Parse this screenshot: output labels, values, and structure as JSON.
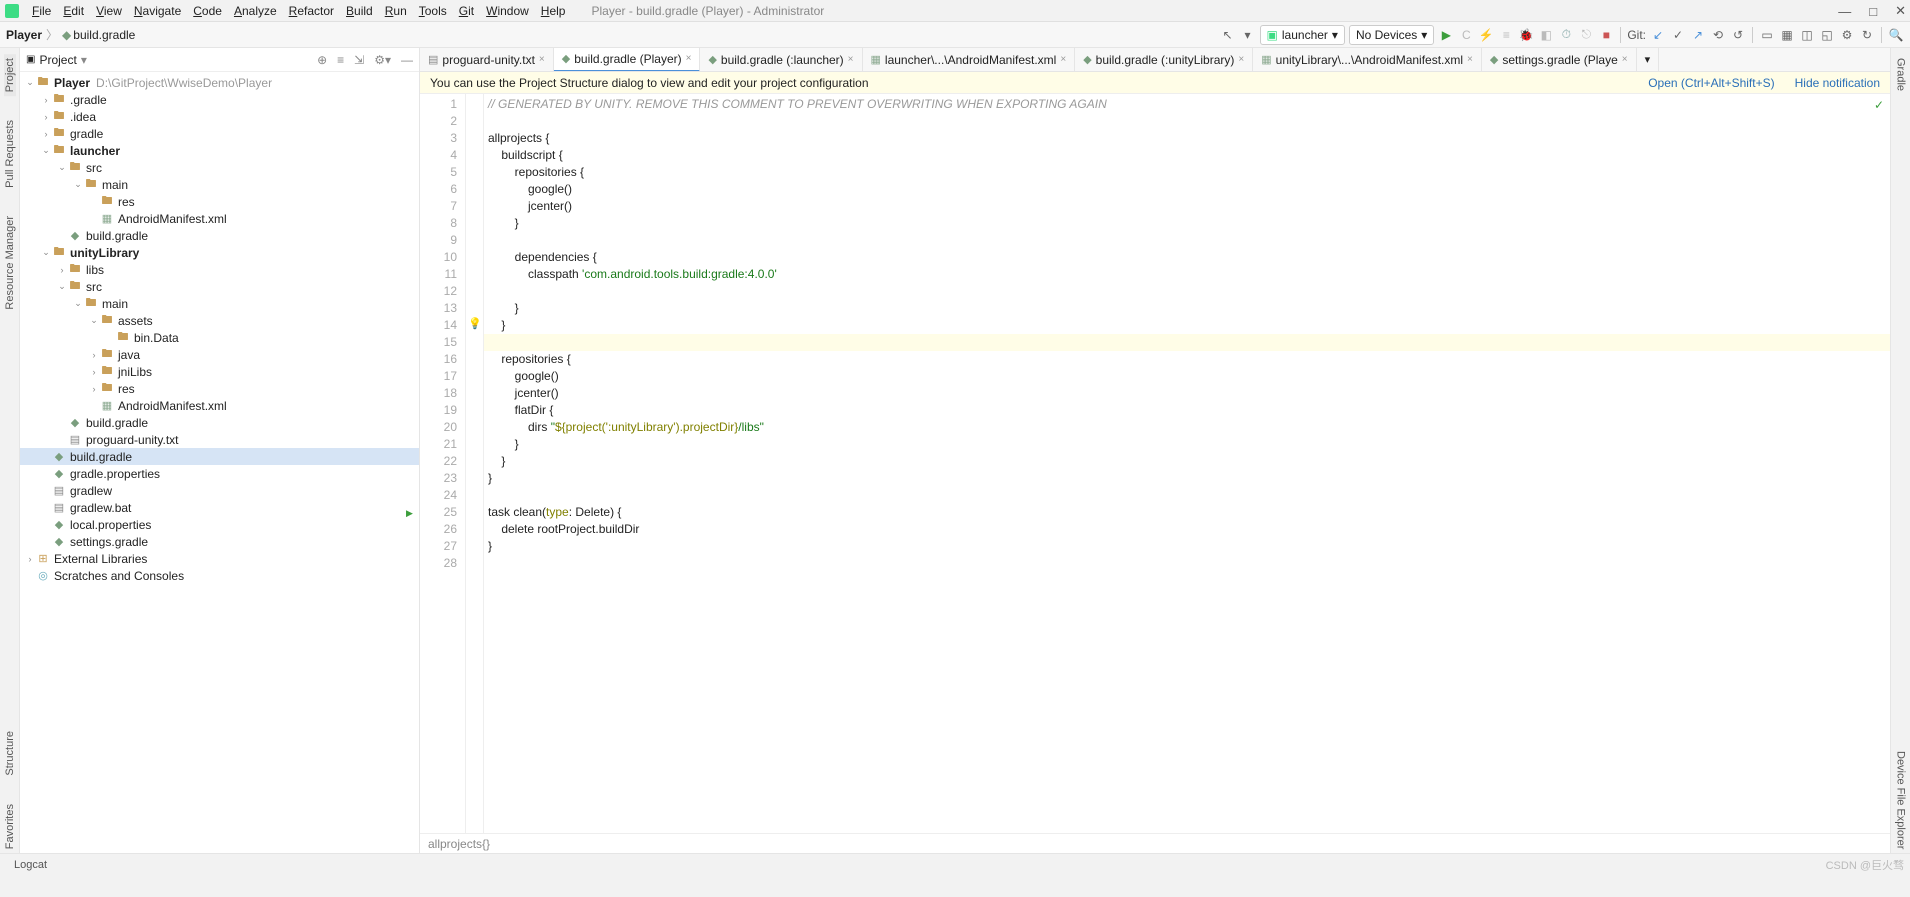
{
  "window": {
    "title": "Player - build.gradle (Player) - Administrator"
  },
  "menu": [
    "File",
    "Edit",
    "View",
    "Navigate",
    "Code",
    "Analyze",
    "Refactor",
    "Build",
    "Run",
    "Tools",
    "Git",
    "Window",
    "Help"
  ],
  "breadcrumb": {
    "root": "Player",
    "file": "build.gradle"
  },
  "toolbar": {
    "run_config": "launcher",
    "devices": "No Devices",
    "git_label": "Git:"
  },
  "project_panel": {
    "title": "Project"
  },
  "tree": [
    {
      "d": 0,
      "a": "v",
      "i": "folder",
      "t": "Player",
      "meta": "D:\\GitProject\\WwiseDemo\\Player",
      "bold": true
    },
    {
      "d": 1,
      "a": ">",
      "i": "folder",
      "t": ".gradle"
    },
    {
      "d": 1,
      "a": ">",
      "i": "folder",
      "t": ".idea"
    },
    {
      "d": 1,
      "a": ">",
      "i": "folder",
      "t": "gradle"
    },
    {
      "d": 1,
      "a": "v",
      "i": "folder",
      "t": "launcher",
      "bold": true
    },
    {
      "d": 2,
      "a": "v",
      "i": "folder",
      "t": "src"
    },
    {
      "d": 3,
      "a": "v",
      "i": "folder",
      "t": "main"
    },
    {
      "d": 4,
      "a": "",
      "i": "folder",
      "t": "res"
    },
    {
      "d": 4,
      "a": "",
      "i": "xfile",
      "t": "AndroidManifest.xml"
    },
    {
      "d": 2,
      "a": "",
      "i": "gfile",
      "t": "build.gradle"
    },
    {
      "d": 1,
      "a": "v",
      "i": "folder",
      "t": "unityLibrary",
      "bold": true
    },
    {
      "d": 2,
      "a": ">",
      "i": "folder",
      "t": "libs"
    },
    {
      "d": 2,
      "a": "v",
      "i": "folder",
      "t": "src"
    },
    {
      "d": 3,
      "a": "v",
      "i": "folder",
      "t": "main"
    },
    {
      "d": 4,
      "a": "v",
      "i": "folder",
      "t": "assets"
    },
    {
      "d": 5,
      "a": "",
      "i": "folder",
      "t": "bin.Data"
    },
    {
      "d": 4,
      "a": ">",
      "i": "folder",
      "t": "java"
    },
    {
      "d": 4,
      "a": ">",
      "i": "folder",
      "t": "jniLibs"
    },
    {
      "d": 4,
      "a": ">",
      "i": "folder",
      "t": "res"
    },
    {
      "d": 4,
      "a": "",
      "i": "xfile",
      "t": "AndroidManifest.xml"
    },
    {
      "d": 2,
      "a": "",
      "i": "gfile",
      "t": "build.gradle"
    },
    {
      "d": 2,
      "a": "",
      "i": "file",
      "t": "proguard-unity.txt"
    },
    {
      "d": 1,
      "a": "",
      "i": "gfile",
      "t": "build.gradle",
      "sel": true
    },
    {
      "d": 1,
      "a": "",
      "i": "gfile",
      "t": "gradle.properties"
    },
    {
      "d": 1,
      "a": "",
      "i": "file",
      "t": "gradlew"
    },
    {
      "d": 1,
      "a": "",
      "i": "file",
      "t": "gradlew.bat"
    },
    {
      "d": 1,
      "a": "",
      "i": "gfile",
      "t": "local.properties"
    },
    {
      "d": 1,
      "a": "",
      "i": "gfile",
      "t": "settings.gradle"
    },
    {
      "d": 0,
      "a": ">",
      "i": "lib",
      "t": "External Libraries"
    },
    {
      "d": 0,
      "a": "",
      "i": "scratch",
      "t": "Scratches and Consoles"
    }
  ],
  "tabs": [
    {
      "icon": "file",
      "label": "proguard-unity.txt"
    },
    {
      "icon": "gfile",
      "label": "build.gradle (Player)",
      "active": true
    },
    {
      "icon": "gfile",
      "label": "build.gradle (:launcher)"
    },
    {
      "icon": "xfile",
      "label": "launcher\\...\\AndroidManifest.xml"
    },
    {
      "icon": "gfile",
      "label": "build.gradle (:unityLibrary)"
    },
    {
      "icon": "xfile",
      "label": "unityLibrary\\...\\AndroidManifest.xml"
    },
    {
      "icon": "gfile",
      "label": "settings.gradle (Playe"
    }
  ],
  "notice": {
    "text": "You can use the Project Structure dialog to view and edit your project configuration",
    "link1": "Open (Ctrl+Alt+Shift+S)",
    "link2": "Hide notification"
  },
  "code_lines": [
    {
      "n": 1,
      "html": "<span class='comment'>// GENERATED BY UNITY. REMOVE THIS COMMENT TO PREVENT OVERWRITING WHEN EXPORTING AGAIN</span>"
    },
    {
      "n": 2,
      "html": ""
    },
    {
      "n": 3,
      "html": "allprojects {"
    },
    {
      "n": 4,
      "html": "    buildscript {"
    },
    {
      "n": 5,
      "html": "        repositories {"
    },
    {
      "n": 6,
      "html": "            google()"
    },
    {
      "n": 7,
      "html": "            jcenter()"
    },
    {
      "n": 8,
      "html": "        }"
    },
    {
      "n": 9,
      "html": ""
    },
    {
      "n": 10,
      "html": "        dependencies {"
    },
    {
      "n": 11,
      "html": "            classpath <span class='str'>'com.android.tools.build:gradle:4.0.0'</span>"
    },
    {
      "n": 12,
      "html": ""
    },
    {
      "n": 13,
      "html": "        }"
    },
    {
      "n": 14,
      "html": "    }",
      "bulb": true
    },
    {
      "n": 15,
      "html": "",
      "hl": true
    },
    {
      "n": 16,
      "html": "    repositories {"
    },
    {
      "n": 17,
      "html": "        google()"
    },
    {
      "n": 18,
      "html": "        jcenter()"
    },
    {
      "n": 19,
      "html": "        flatDir {"
    },
    {
      "n": 20,
      "html": "            dirs <span class='str'>\"</span><span class='ann'>${project(':unityLibrary').projectDir}</span><span class='str'>/libs\"</span>"
    },
    {
      "n": 21,
      "html": "        }"
    },
    {
      "n": 22,
      "html": "    }"
    },
    {
      "n": 23,
      "html": "}"
    },
    {
      "n": 24,
      "html": ""
    },
    {
      "n": 25,
      "html": "task clean(<span class='ann'>type</span>: Delete) {",
      "run": true
    },
    {
      "n": 26,
      "html": "    delete rootProject.buildDir"
    },
    {
      "n": 27,
      "html": "}"
    },
    {
      "n": 28,
      "html": ""
    }
  ],
  "crumb": "allprojects{}",
  "bottom": {
    "logcat": "Logcat",
    "watermark": "CSDN @巨火骛"
  },
  "left_tabs": [
    "Project",
    "Pull Requests",
    "Resource Manager",
    "Structure",
    "Favorites"
  ],
  "right_tabs": [
    "Gradle",
    "Device File Explorer"
  ]
}
